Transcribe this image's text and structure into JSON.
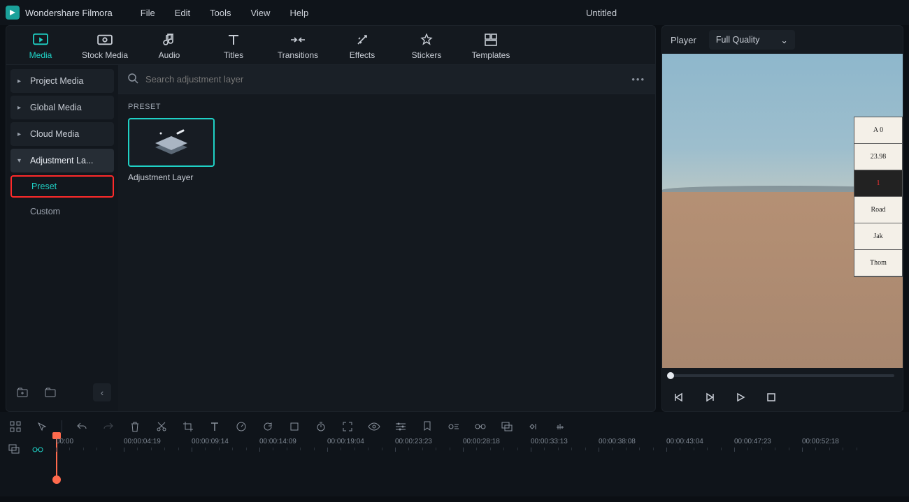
{
  "app_name": "Wondershare Filmora",
  "doc_title": "Untitled",
  "menu": [
    "File",
    "Edit",
    "Tools",
    "View",
    "Help"
  ],
  "tabs": [
    {
      "label": "Media",
      "icon": "media"
    },
    {
      "label": "Stock Media",
      "icon": "stock"
    },
    {
      "label": "Audio",
      "icon": "audio"
    },
    {
      "label": "Titles",
      "icon": "titles"
    },
    {
      "label": "Transitions",
      "icon": "transitions"
    },
    {
      "label": "Effects",
      "icon": "effects"
    },
    {
      "label": "Stickers",
      "icon": "stickers"
    },
    {
      "label": "Templates",
      "icon": "templates"
    }
  ],
  "sidebar": {
    "items": [
      {
        "label": "Project Media"
      },
      {
        "label": "Global Media"
      },
      {
        "label": "Cloud Media"
      },
      {
        "label": "Adjustment La..."
      }
    ],
    "subs": {
      "preset": "Preset",
      "custom": "Custom"
    }
  },
  "search": {
    "placeholder": "Search adjustment layer"
  },
  "content": {
    "section_title": "PRESET",
    "asset_label": "Adjustment Layer"
  },
  "preview": {
    "player_label": "Player",
    "quality_label": "Full Quality",
    "clapper_rows": [
      "A 0",
      "23.98",
      "1",
      "Road",
      "Jak",
      "Thom"
    ]
  },
  "timeline": {
    "ticks": [
      "00:00",
      "00:00:04:19",
      "00:00:09:14",
      "00:00:14:09",
      "00:00:19:04",
      "00:00:23:23",
      "00:00:28:18",
      "00:00:33:13",
      "00:00:38:08",
      "00:00:43:04",
      "00:00:47:23",
      "00:00:52:18"
    ]
  }
}
